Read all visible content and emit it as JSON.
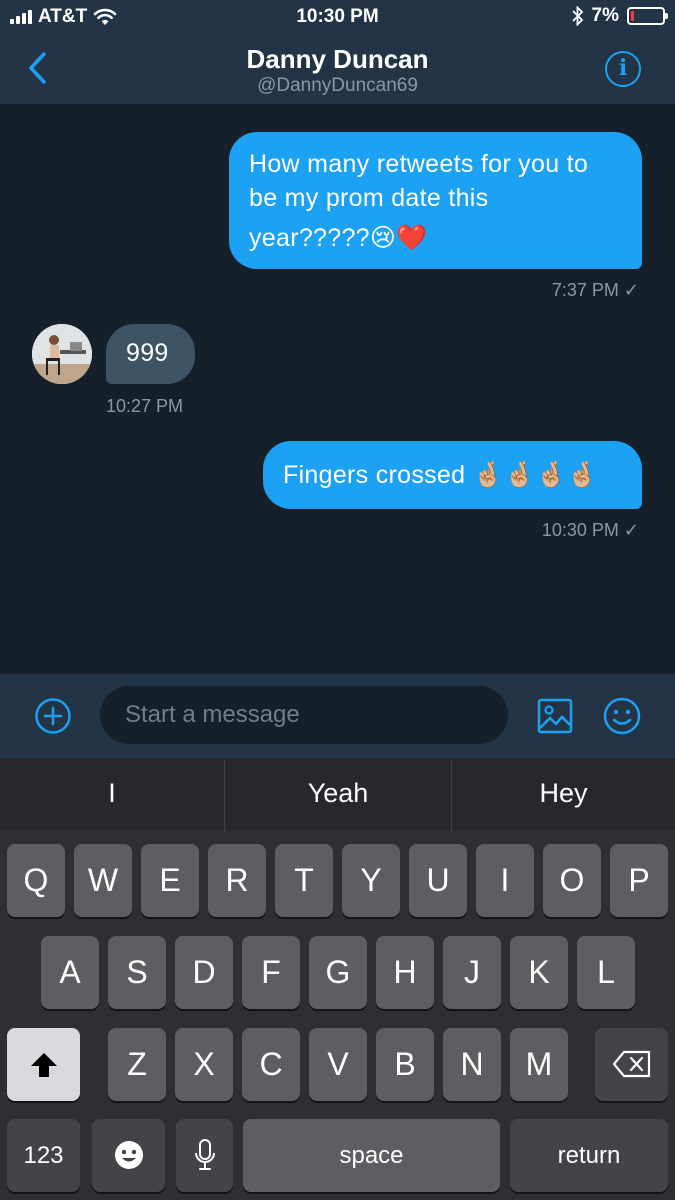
{
  "status_bar": {
    "carrier": "AT&T",
    "time": "10:30 PM",
    "battery": "7%",
    "icons": [
      "signal-icon",
      "wifi-icon",
      "bluetooth-icon",
      "battery-icon"
    ]
  },
  "header": {
    "name": "Danny Duncan",
    "handle": "@DannyDuncan69",
    "back_icon": "chevron-left-icon",
    "info_icon": "info-icon"
  },
  "messages": [
    {
      "direction": "sent",
      "line1": "How many retweets for you to",
      "line2": "be my prom date this",
      "line3": "year?????😢❤️",
      "time": "7:37 PM ✓"
    },
    {
      "direction": "received",
      "text": "999",
      "time": "10:27 PM"
    },
    {
      "direction": "sent",
      "text": "Fingers crossed 🤞🏼🤞🏼🤞🏼🤞🏼",
      "time": "10:30 PM ✓"
    }
  ],
  "composer": {
    "placeholder": "Start a message",
    "add_icon": "plus-circle-icon",
    "media_icon": "image-icon",
    "emoji_icon": "smiley-icon"
  },
  "keyboard": {
    "suggestions": [
      "I",
      "Yeah",
      "Hey"
    ],
    "row1": [
      "Q",
      "W",
      "E",
      "R",
      "T",
      "Y",
      "U",
      "I",
      "O",
      "P"
    ],
    "row2": [
      "A",
      "S",
      "D",
      "F",
      "G",
      "H",
      "J",
      "K",
      "L"
    ],
    "row3": [
      "Z",
      "X",
      "C",
      "V",
      "B",
      "N",
      "M"
    ],
    "numbers_key": "123",
    "space_key": "space",
    "return_key": "return"
  },
  "colors": {
    "accent": "#1da1f2",
    "background": "#15202b",
    "surface": "#243447",
    "received_bubble": "#3d5466",
    "muted_text": "#8899a6"
  }
}
